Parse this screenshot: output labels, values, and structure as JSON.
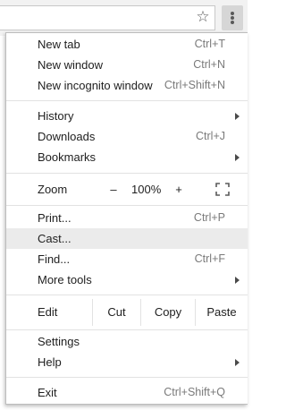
{
  "toolbar": {
    "star_icon": "star-outline-icon",
    "menu_icon": "kebab-menu-icon"
  },
  "menu": {
    "group1": [
      {
        "label": "New tab",
        "shortcut": "Ctrl+T"
      },
      {
        "label": "New window",
        "shortcut": "Ctrl+N"
      },
      {
        "label": "New incognito window",
        "shortcut": "Ctrl+Shift+N"
      }
    ],
    "group2": [
      {
        "label": "History",
        "submenu": true
      },
      {
        "label": "Downloads",
        "shortcut": "Ctrl+J"
      },
      {
        "label": "Bookmarks",
        "submenu": true
      }
    ],
    "zoom": {
      "label": "Zoom",
      "minus": "–",
      "value": "100%",
      "plus": "+",
      "fullscreen_icon": "fullscreen-icon"
    },
    "group3": [
      {
        "label": "Print...",
        "shortcut": "Ctrl+P"
      },
      {
        "label": "Cast...",
        "highlighted": true
      },
      {
        "label": "Find...",
        "shortcut": "Ctrl+F"
      },
      {
        "label": "More tools",
        "submenu": true
      }
    ],
    "edit": {
      "label": "Edit",
      "cut": "Cut",
      "copy": "Copy",
      "paste": "Paste"
    },
    "group4": [
      {
        "label": "Settings"
      },
      {
        "label": "Help",
        "submenu": true
      }
    ],
    "group5": [
      {
        "label": "Exit",
        "shortcut": "Ctrl+Shift+Q"
      }
    ]
  },
  "colors": {
    "toolbar_bg": "#f2f2f2",
    "menu_bg": "#ffffff",
    "highlight_bg": "#ebebeb",
    "shortcut_text": "#7a7a7a",
    "separator": "#e2e2e2"
  }
}
